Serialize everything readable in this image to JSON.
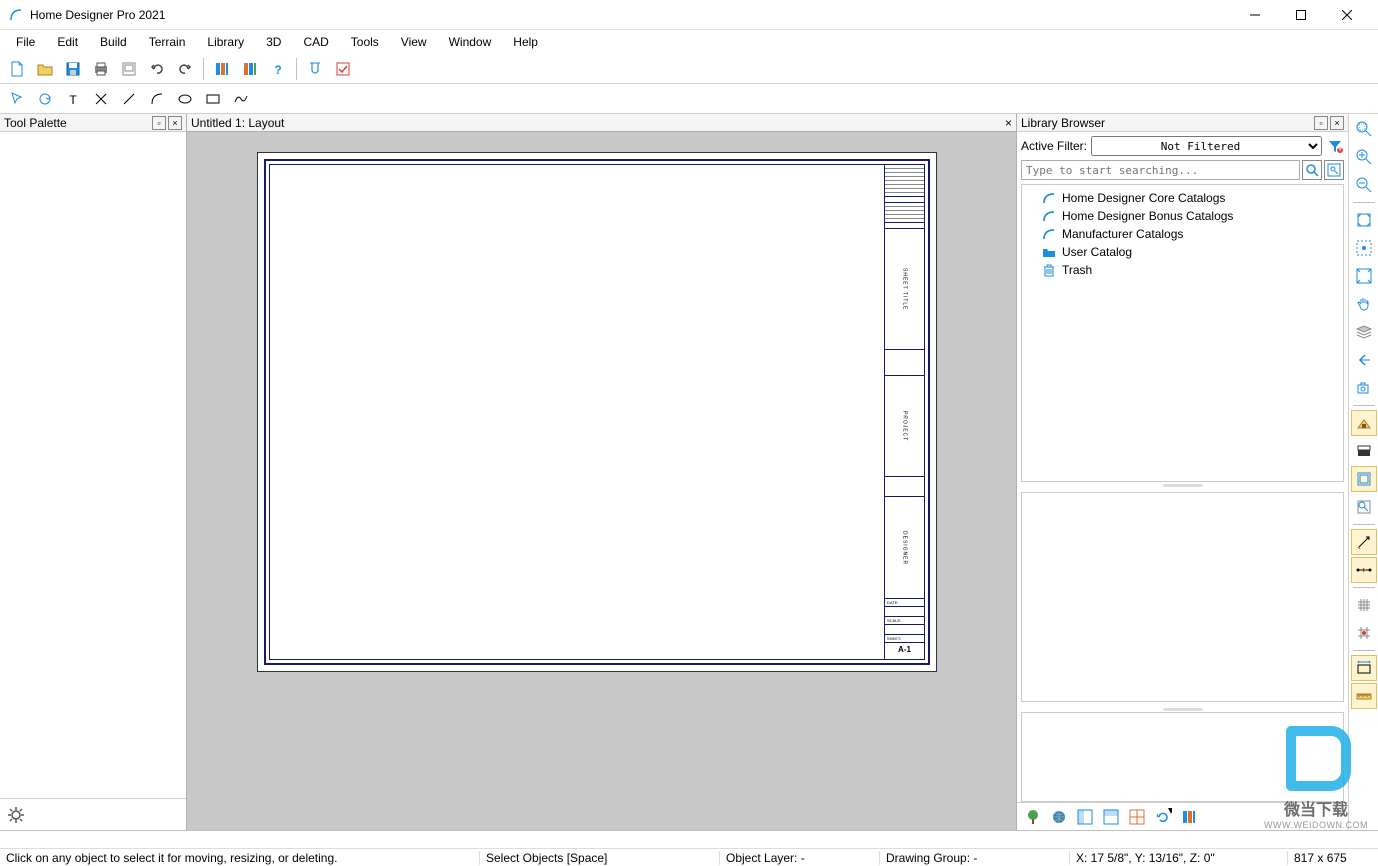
{
  "app": {
    "title": "Home Designer Pro 2021"
  },
  "menu": [
    "File",
    "Edit",
    "Build",
    "Terrain",
    "Library",
    "3D",
    "CAD",
    "Tools",
    "View",
    "Window",
    "Help"
  ],
  "panel": {
    "tool_palette": "Tool Palette",
    "library_browser": "Library Browser",
    "doc_tab": "Untitled 1: Layout"
  },
  "filter": {
    "label": "Active Filter:",
    "value": "Not Filtered",
    "search_placeholder": "Type to start searching..."
  },
  "tree": [
    {
      "label": "Home Designer Core Catalogs",
      "icon": "house"
    },
    {
      "label": "Home Designer Bonus Catalogs",
      "icon": "house"
    },
    {
      "label": "Manufacturer Catalogs",
      "icon": "house"
    },
    {
      "label": "User Catalog",
      "icon": "folder"
    },
    {
      "label": "Trash",
      "icon": "trash"
    }
  ],
  "titleblock": {
    "sheet_title": "SHEET TITLE",
    "project": "PROJECT",
    "designer": "DESIGNER",
    "date": "DATE:",
    "scale": "SCALE:",
    "sheet": "SHEET:",
    "sheet_num": "A-1"
  },
  "status": {
    "hint": "Click on any object to select it for moving, resizing, or deleting.",
    "select": "Select Objects [Space]",
    "layer": "Object Layer: -",
    "group": "Drawing Group: -",
    "coords": "X: 17 5/8\", Y: 13/16\", Z: 0\"",
    "dim": "817 x 675"
  },
  "watermark": {
    "text1": "微当下载",
    "text2": "WWW.WEIDOWN.COM"
  },
  "colors": {
    "accent": "#1f8de0",
    "frame": "#1a1a6a"
  }
}
